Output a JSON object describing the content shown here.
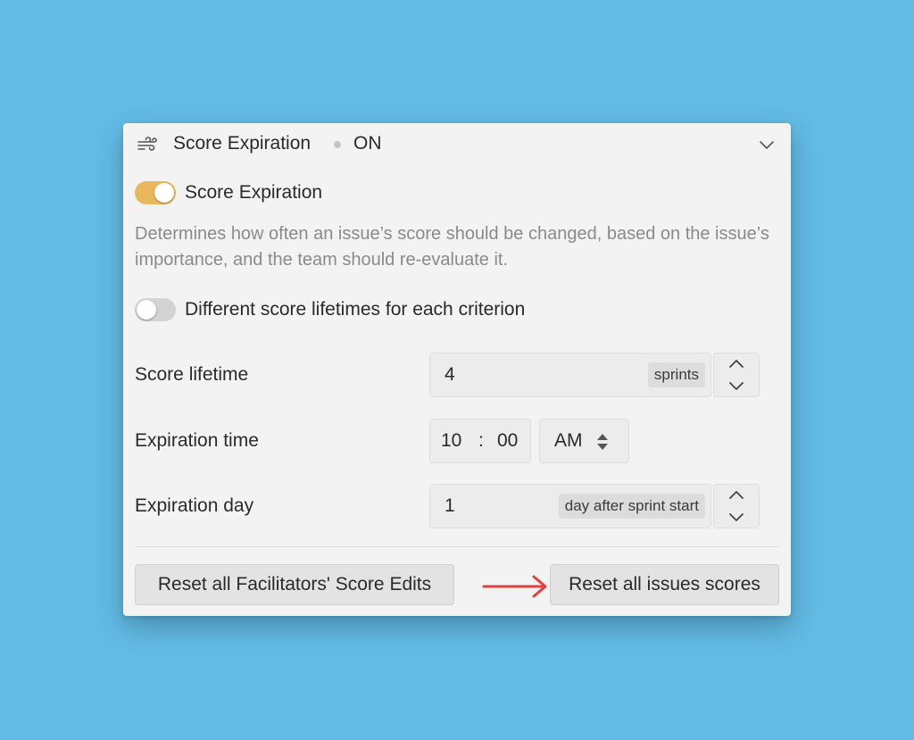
{
  "header": {
    "title": "Score Expiration",
    "status": "ON",
    "icon": "wind-icon",
    "chevron_icon": "chevron-down-icon"
  },
  "expiration_toggle": {
    "label": "Score Expiration",
    "state": "on"
  },
  "description": "Determines how often an issue’s score should be changed, based on the issue’s importance, and the team should re-evaluate it.",
  "criterion_toggle": {
    "label": "Different score lifetimes for each criterion",
    "state": "off"
  },
  "score_lifetime": {
    "label": "Score lifetime",
    "value": "4",
    "unit": "sprints"
  },
  "expiration_time": {
    "label": "Expiration time",
    "hour": "10",
    "separator": ":",
    "minute": "00",
    "period": "AM"
  },
  "expiration_day": {
    "label": "Expiration day",
    "value": "1",
    "unit": "day after sprint start"
  },
  "buttons": {
    "reset_edits": "Reset all Facilitators' Score Edits",
    "reset_scores": "Reset all issues scores"
  },
  "colors": {
    "background": "#62bbe5",
    "panel": "#f3f3f3",
    "toggle_on": "#e9b85c",
    "toggle_off": "#d3d3d3",
    "arrow": "#e0403f"
  }
}
